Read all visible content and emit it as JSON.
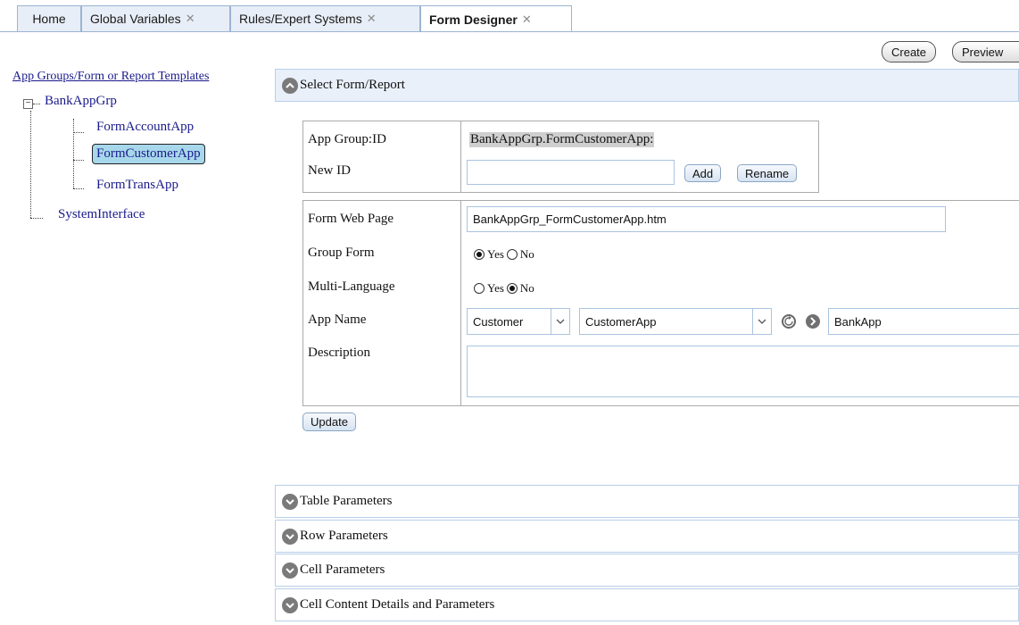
{
  "tabs": [
    {
      "label": "Home",
      "closable": false
    },
    {
      "label": "Global Variables",
      "closable": true
    },
    {
      "label": "Rules/Expert Systems",
      "closable": true
    },
    {
      "label": "Form Designer",
      "closable": true,
      "active": true
    }
  ],
  "toolbar": {
    "create_label": "Create",
    "preview_label": "Preview"
  },
  "tree": {
    "root_label": "App Groups/Form or Report Templates",
    "group_label": "BankAppGrp",
    "children": [
      "FormAccountApp",
      "FormCustomerApp",
      "FormTransApp"
    ],
    "selected": "FormCustomerApp",
    "sibling_label": "SystemInterface"
  },
  "sections": {
    "select_form": "Select Form/Report",
    "table_params": "Table Parameters",
    "row_params": "Row Parameters",
    "cell_params": "Cell Parameters",
    "cell_content": "Cell Content Details and Parameters"
  },
  "form": {
    "app_group_id_label": "App Group:ID",
    "app_group_id_value": "BankAppGrp.FormCustomerApp:",
    "new_id_label": "New ID",
    "new_id_value": "",
    "add_label": "Add",
    "rename_label": "Rename",
    "web_page_label": "Form Web Page",
    "web_page_value": "BankAppGrp_FormCustomerApp.htm",
    "group_form_label": "Group Form",
    "group_form_value": "Yes",
    "multi_lang_label": "Multi-Language",
    "multi_lang_value": "No",
    "yes_label": "Yes",
    "no_label": "No",
    "app_name_label": "App Name",
    "app_name_select1": "Customer",
    "app_name_select2": "CustomerApp",
    "app_name_value": "BankApp",
    "description_label": "Description",
    "description_value": "",
    "update_label": "Update"
  },
  "colors": {
    "accent": "#e9f0fa",
    "selected_node": "#a7d7ea",
    "border": "#9bb4d3"
  }
}
